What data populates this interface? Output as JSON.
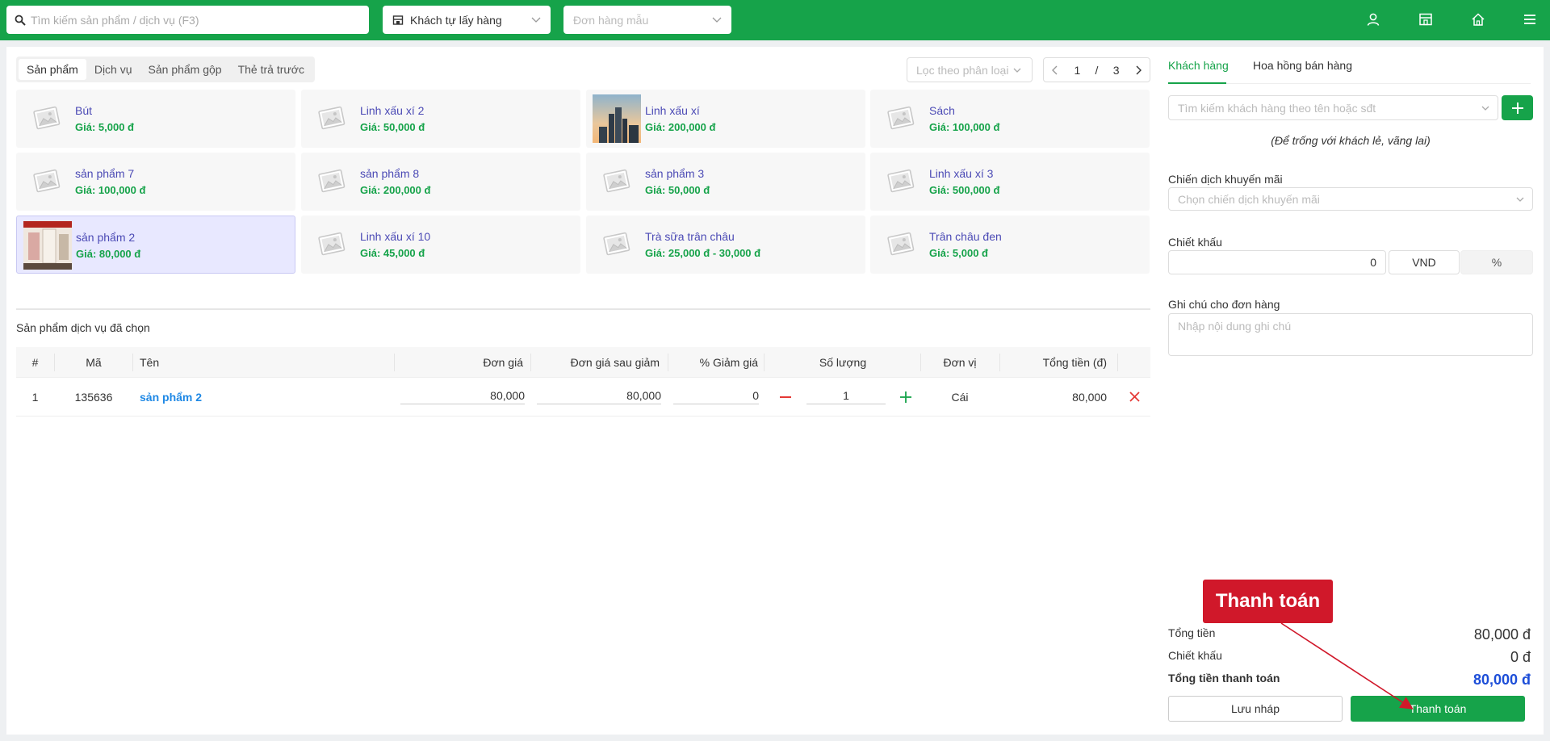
{
  "topbar": {
    "search_placeholder": "Tìm kiếm sản phẩm / dịch vụ (F3)",
    "delivery_select": "Khách tự lấy hàng",
    "template_order_placeholder": "Đơn hàng mẫu",
    "icons": [
      "user-icon",
      "store-icon",
      "home-icon",
      "menu-icon"
    ]
  },
  "catalog": {
    "tabs": [
      "Sản phẩm",
      "Dịch vụ",
      "Sản phẩm gộp",
      "Thẻ trả trước"
    ],
    "active_tab": "Sản phẩm",
    "filter_placeholder": "Lọc theo phân loại",
    "pager": {
      "current": "1",
      "sep": "/",
      "total": "3"
    },
    "products": [
      {
        "name": "Bút",
        "price": "Giá: 5,000 đ",
        "image": "placeholder"
      },
      {
        "name": "Linh xấu xí 2",
        "price": "Giá: 50,000 đ",
        "image": "placeholder"
      },
      {
        "name": "Linh xấu xí",
        "price": "Giá: 200,000 đ",
        "image": "city-photo"
      },
      {
        "name": "Sách",
        "price": "Giá: 100,000 đ",
        "image": "placeholder"
      },
      {
        "name": "sản phẩm 7",
        "price": "Giá: 100,000 đ",
        "image": "placeholder"
      },
      {
        "name": "sản phẩm 8",
        "price": "Giá: 200,000 đ",
        "image": "placeholder"
      },
      {
        "name": "sản phẩm 3",
        "price": "Giá: 50,000 đ",
        "image": "placeholder"
      },
      {
        "name": "Linh xấu xí 3",
        "price": "Giá: 500,000 đ",
        "image": "placeholder"
      },
      {
        "name": "sản phẩm 2",
        "price": "Giá: 80,000 đ",
        "image": "product-photo",
        "selected": true
      },
      {
        "name": "Linh xấu xí 10",
        "price": "Giá: 45,000 đ",
        "image": "placeholder"
      },
      {
        "name": "Trà sữa trân châu",
        "price": "Giá: 25,000 đ - 30,000 đ",
        "image": "placeholder"
      },
      {
        "name": "Trân châu đen",
        "price": "Giá: 5,000 đ",
        "image": "placeholder"
      }
    ]
  },
  "selected_items": {
    "title": "Sản phẩm dịch vụ đã chọn",
    "columns": [
      "#",
      "Mã",
      "Tên",
      "Đơn giá",
      "Đơn giá sau giảm",
      "% Giảm giá",
      "Số lượng",
      "Đơn vị",
      "Tổng tiền (đ)"
    ],
    "rows": [
      {
        "index": "1",
        "code": "135636",
        "name": "sản phẩm 2",
        "unit_price": "80,000",
        "discounted_price": "80,000",
        "discount_percent": "0",
        "quantity": "1",
        "unit": "Cái",
        "total": "80,000"
      }
    ]
  },
  "customer_panel": {
    "tabs": [
      "Khách hàng",
      "Hoa hồng bán hàng"
    ],
    "active_tab": "Khách hàng",
    "customer_search_placeholder": "Tìm kiếm khách hàng theo tên hoặc sđt",
    "walkin_hint": "(Để trống với khách lẻ, vãng lai)",
    "promotion_label": "Chiến dịch khuyến mãi",
    "promotion_placeholder": "Chọn chiến dịch khuyến mãi",
    "discount_label": "Chiết khấu",
    "discount_value": "0",
    "discount_unit_vnd": "VND",
    "discount_unit_percent": "%",
    "note_label": "Ghi chú cho đơn hàng",
    "note_placeholder": "Nhập nội dung ghi chú"
  },
  "summary": {
    "total_label": "Tổng tiền",
    "total_value": "80,000 đ",
    "discount_label": "Chiết khấu",
    "discount_value": "0 đ",
    "payable_label": "Tổng tiền thanh toán",
    "payable_value": "80,000 đ",
    "draft_button": "Lưu nháp",
    "pay_button": "Thanh toán"
  },
  "annotation": {
    "callout": "Thanh toán",
    "callout_color": "#d0182a"
  },
  "colors": {
    "brand": "#16a34a",
    "link": "#4b4ab5",
    "payable": "#1d4ed8",
    "remove": "#e53935"
  }
}
